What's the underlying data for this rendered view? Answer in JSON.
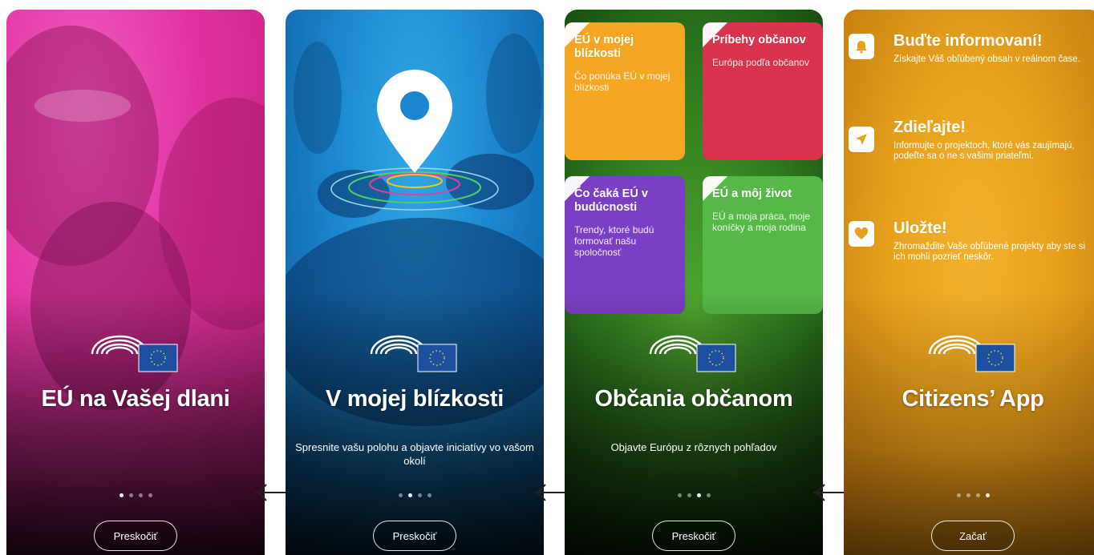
{
  "screens": [
    {
      "title": "EÚ na Vašej dlani",
      "subtitle": "",
      "button": "Preskočiť",
      "active_dot": 0
    },
    {
      "title": "V mojej blízkosti",
      "subtitle": "Spresnite vašu polohu a objavte iniciatívy vo vašom okolí",
      "button": "Preskočiť",
      "active_dot": 1
    },
    {
      "title": "Občania občanom",
      "subtitle": "Objavte Európu z rôznych pohľadov",
      "button": "Preskočiť",
      "active_dot": 2,
      "cards": [
        {
          "title": "EÚ v mojej blízkosti",
          "desc": "Čo ponúka EÚ v mojej blízkosti",
          "color": "#f5a623"
        },
        {
          "title": "Príbehy občanov",
          "desc": "Európa podľa občanov",
          "color": "#d9344d"
        },
        {
          "title": "Čo čaká EÚ v budúcnosti",
          "desc": "Trendy, ktoré budú formovať našu spoločnosť",
          "color": "#7b3fc4"
        },
        {
          "title": "EÚ a môj život",
          "desc": "EÚ a moja práca, moje koníčky a moja rodina",
          "color": "#56b947"
        }
      ]
    },
    {
      "title": "Citizens’ App",
      "subtitle": "",
      "button": "Začať",
      "active_dot": 3,
      "features": [
        {
          "title": "Buďte informovaní!",
          "desc": "Získajte Váš obľúbený obsah v reálnom čase.",
          "icon": "bell-icon"
        },
        {
          "title": "Zdieľajte!",
          "desc": "Informujte o projektoch, ktoré vás zaujímajú, podeľte sa o ne s vašimi priateľmi.",
          "icon": "send-icon"
        },
        {
          "title": "Uložte!",
          "desc": "Zhromaždite Vaše obľúbené projekty aby ste si ich mohli pozrieť neskôr.",
          "icon": "heart-icon"
        }
      ]
    }
  ],
  "colors": {
    "screen1": "#e0329f",
    "screen2": "#1b86cf",
    "screen3": "#2e7a1e",
    "screen4": "#e8a11c",
    "eu_flag": "#1d4fa1",
    "eu_star": "#f5d90a"
  }
}
